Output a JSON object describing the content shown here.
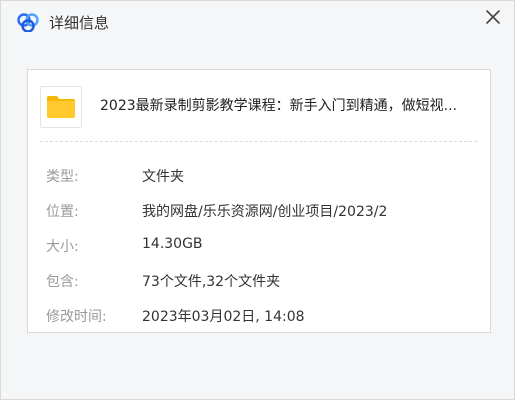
{
  "window": {
    "title": "详细信息",
    "icons": {
      "app": "baidu-netdisk-logo-icon",
      "close": "close-icon",
      "item": "folder-icon"
    },
    "colors": {
      "accent": "#2a6df5",
      "folder": "#ffc92e",
      "folder_back": "#f5b800"
    }
  },
  "item": {
    "name": "2023最新录制剪影教学课程：新手入门到精通，做短视..."
  },
  "details": [
    {
      "label": "类型:",
      "value": "文件夹"
    },
    {
      "label": "位置:",
      "value": "我的网盘/乐乐资源网/创业项目/2023/2"
    },
    {
      "label": "大小:",
      "value": "14.30GB"
    },
    {
      "label": "包含:",
      "value": "73个文件,32个文件夹"
    },
    {
      "label": "修改时间:",
      "value": "2023年03月02日, 14:08"
    }
  ]
}
